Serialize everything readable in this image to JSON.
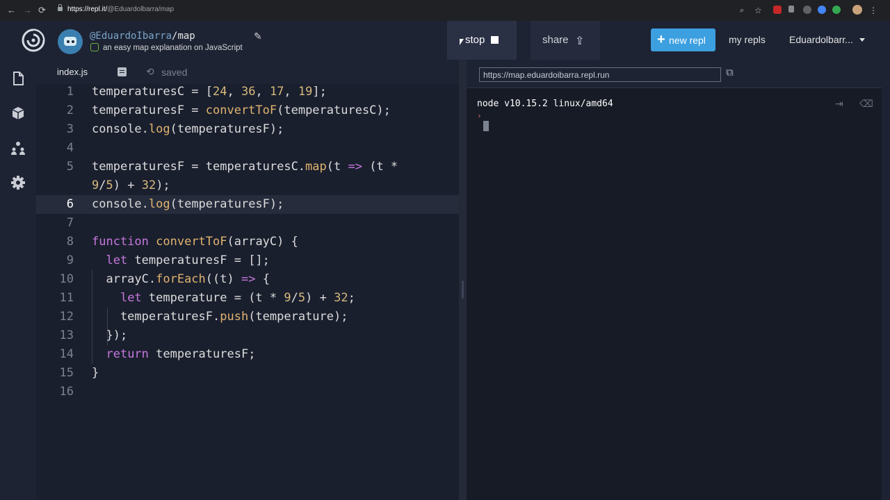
{
  "browser": {
    "back": "←",
    "forward": "→",
    "reload": "⟳",
    "url_host": "https://repl.it/",
    "url_path": "@Eduardolbarra/map"
  },
  "header": {
    "owner": "@EduardoIbarra",
    "slash": "/",
    "repl_name": "map",
    "pencil": "✎",
    "description": "an easy map explanation on JavaScript",
    "stop_label": "stop",
    "share_label": "share",
    "share_icon": "⇪",
    "new_plus": "+",
    "new_repl_label": "new repl",
    "my_repls": "my repls",
    "username": "Eduardolbarr..."
  },
  "editor": {
    "filename": "index.js",
    "saved_icon": "⟲",
    "saved": "saved",
    "active_line": 6,
    "lines": [
      {
        "n": "1",
        "code": "temperaturesC = [24, 36, 17, 19];"
      },
      {
        "n": "2",
        "code": "temperaturesF = convertToF(temperaturesC);"
      },
      {
        "n": "3",
        "code": "console.log(temperaturesF);"
      },
      {
        "n": "4",
        "code": ""
      },
      {
        "n": "5",
        "code": "temperaturesF = temperaturesC.map(t => (t *",
        "wrap": "9/5) + 32);"
      },
      {
        "n": "6",
        "code": "console.log(temperaturesF);"
      },
      {
        "n": "7",
        "code": ""
      },
      {
        "n": "8",
        "code": "function convertToF(arrayC) {"
      },
      {
        "n": "9",
        "code": "  let temperaturesF = [];"
      },
      {
        "n": "10",
        "code": "  arrayC.forEach((t) => {"
      },
      {
        "n": "11",
        "code": "    let temperature = (t * 9/5) + 32;"
      },
      {
        "n": "12",
        "code": "    temperaturesF.push(temperature);"
      },
      {
        "n": "13",
        "code": "  });"
      },
      {
        "n": "14",
        "code": "  return temperaturesF;"
      },
      {
        "n": "15",
        "code": "}"
      },
      {
        "n": "16",
        "code": ""
      }
    ]
  },
  "webview": {
    "url": "https://map.eduardoibarra.repl.run",
    "open_icon": "⧉"
  },
  "console": {
    "version_line": "node v10.15.2 linux/amd64",
    "prompt": "›",
    "clear_icon": "⌫",
    "toggle_icon": "⇥"
  },
  "colors": {
    "accent": "#3c9fdf",
    "background": "#1d2333",
    "editor_bg": "#1a1f2e",
    "keyword": "#c678dd",
    "function": "#e5c07b"
  }
}
